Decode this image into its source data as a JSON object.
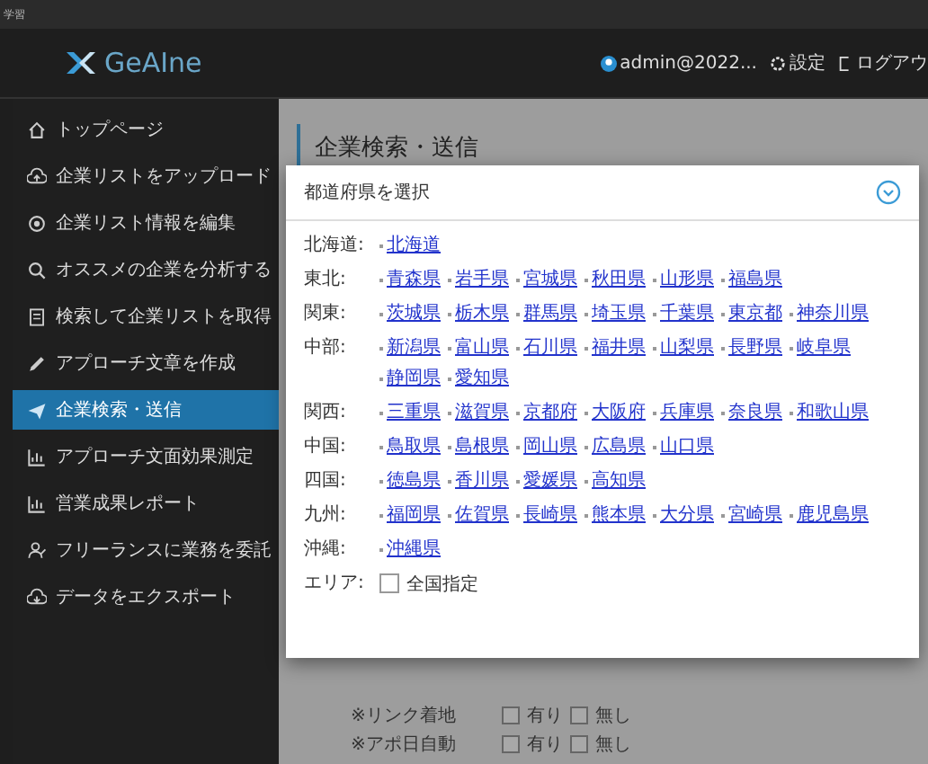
{
  "top_bar": {
    "text": "学習"
  },
  "header": {
    "logo": "GeAIne",
    "user": "admin@2022...",
    "settings": "設定",
    "logout": "ログアウ"
  },
  "sidebar": {
    "items": [
      {
        "label": "トップページ",
        "selected": false
      },
      {
        "label": "企業リストをアップロード",
        "selected": false
      },
      {
        "label": "企業リスト情報を編集",
        "selected": false
      },
      {
        "label": "オススメの企業を分析する",
        "selected": false
      },
      {
        "label": "検索して企業リストを取得",
        "selected": false
      },
      {
        "label": "アプローチ文章を作成",
        "selected": false
      },
      {
        "label": "企業検索・送信",
        "selected": true
      },
      {
        "label": "アプローチ文面効果測定",
        "selected": false
      },
      {
        "label": "営業成果レポート",
        "selected": false
      },
      {
        "label": "フリーランスに業務を委託",
        "selected": false
      },
      {
        "label": "データをエクスポート",
        "selected": false
      }
    ]
  },
  "page": {
    "title": "企業検索・送信",
    "options": [
      {
        "label": "※リンク着地",
        "choices": [
          {
            "label": "有り",
            "checked": false
          },
          {
            "label": "無し",
            "checked": false
          }
        ]
      },
      {
        "label": "※アポ日自動",
        "choices": [
          {
            "label": "有り",
            "checked": false
          },
          {
            "label": "無し",
            "checked": false
          }
        ]
      }
    ]
  },
  "modal": {
    "title": "都道府県を選択",
    "regions": [
      {
        "name": "北海道:",
        "prefectures": [
          "北海道"
        ]
      },
      {
        "name": "東北:",
        "prefectures": [
          "青森県",
          "岩手県",
          "宮城県",
          "秋田県",
          "山形県",
          "福島県"
        ]
      },
      {
        "name": "関東:",
        "prefectures": [
          "茨城県",
          "栃木県",
          "群馬県",
          "埼玉県",
          "千葉県",
          "東京都",
          "神奈川県"
        ]
      },
      {
        "name": "中部:",
        "prefectures": [
          "新潟県",
          "富山県",
          "石川県",
          "福井県",
          "山梨県",
          "長野県",
          "岐阜県",
          "静岡県",
          "愛知県"
        ]
      },
      {
        "name": "関西:",
        "prefectures": [
          "三重県",
          "滋賀県",
          "京都府",
          "大阪府",
          "兵庫県",
          "奈良県",
          "和歌山県"
        ]
      },
      {
        "name": "中国:",
        "prefectures": [
          "鳥取県",
          "島根県",
          "岡山県",
          "広島県",
          "山口県"
        ]
      },
      {
        "name": "四国:",
        "prefectures": [
          "徳島県",
          "香川県",
          "愛媛県",
          "高知県"
        ]
      },
      {
        "name": "九州:",
        "prefectures": [
          "福岡県",
          "佐賀県",
          "長崎県",
          "熊本県",
          "大分県",
          "宮崎県",
          "鹿児島県"
        ]
      },
      {
        "name": "沖縄:",
        "prefectures": [
          "沖縄県"
        ]
      }
    ],
    "area": {
      "label": "エリア:",
      "option": "全国指定",
      "checked": false
    }
  }
}
